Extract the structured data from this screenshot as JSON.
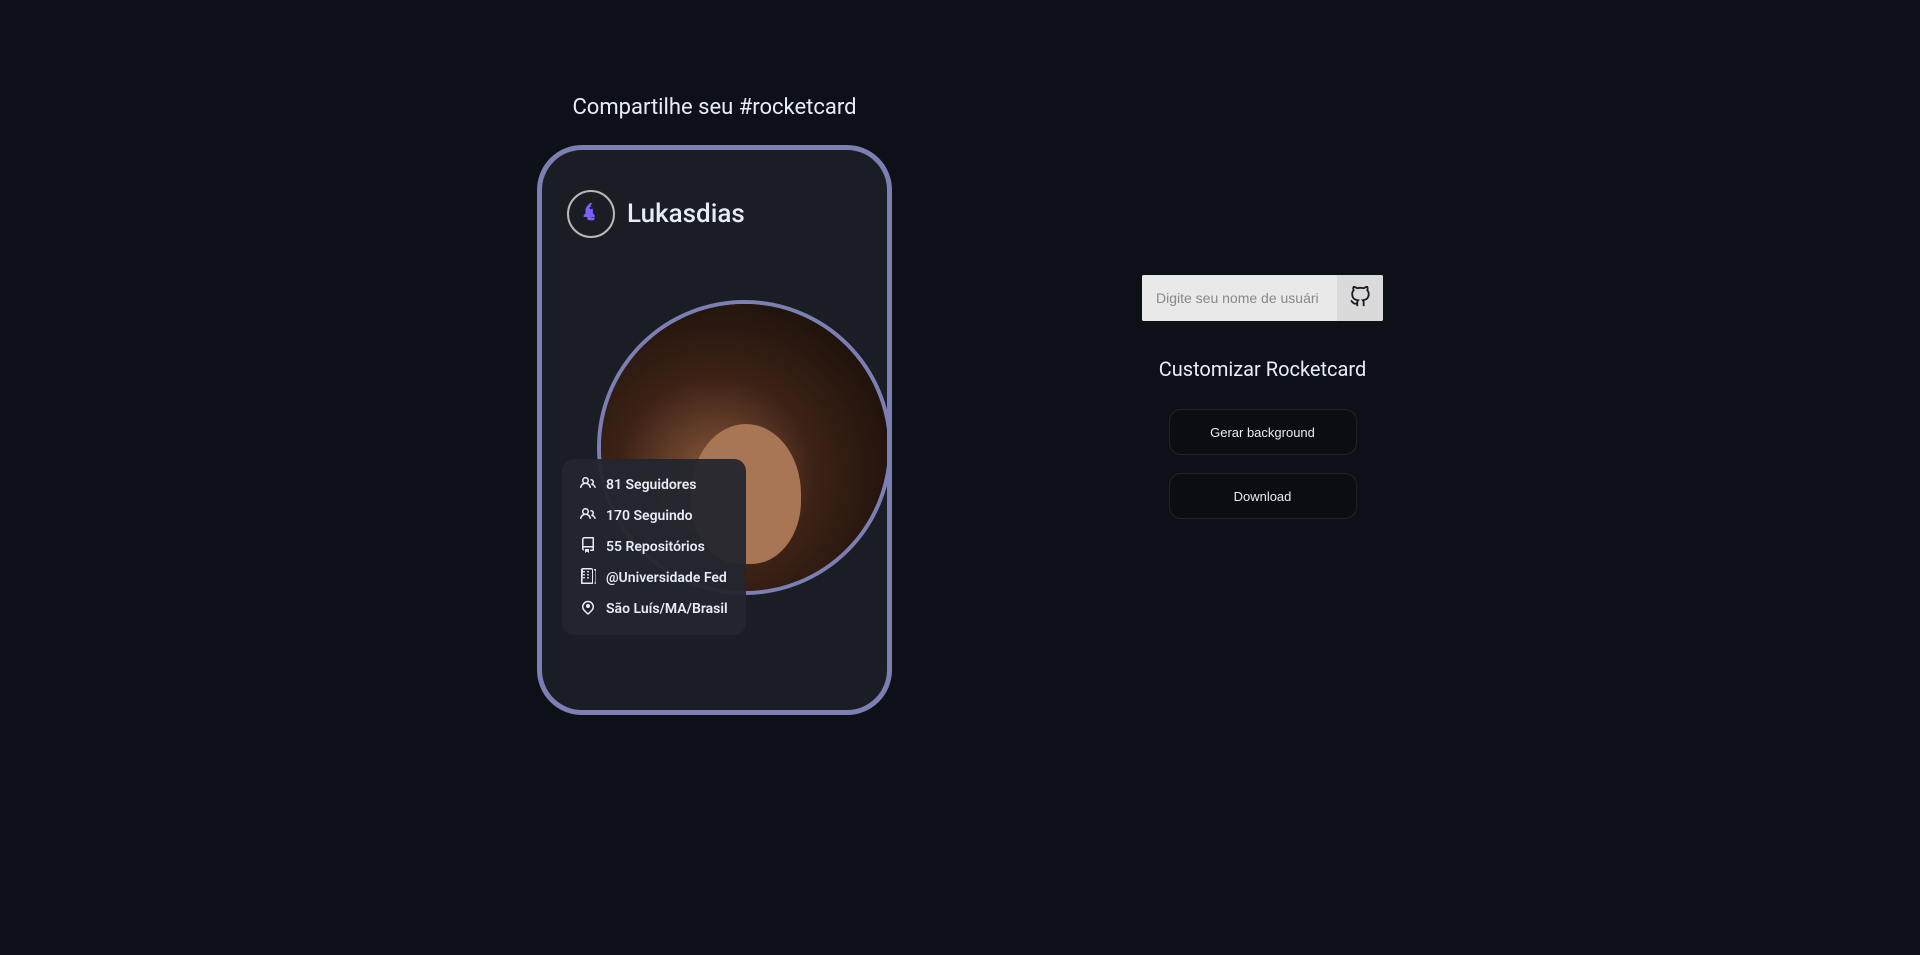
{
  "share_title": "Compartilhe seu #rocketcard",
  "card": {
    "username": "Lukasdias",
    "stats": {
      "followers_count": "81",
      "followers_label": "Seguidores",
      "following_count": "170",
      "following_label": "Seguindo",
      "repos_count": "55",
      "repos_label": "Repositórios",
      "company": "@Universidade Fed",
      "location": "São Luís/MA/Brasil"
    }
  },
  "sidebar": {
    "search_placeholder": "Digite seu nome de usuári",
    "customize_title": "Customizar Rocketcard",
    "generate_bg_label": "Gerar background",
    "download_label": "Download"
  },
  "colors": {
    "background": "#0d1117",
    "card_bg": "#1a1d24",
    "border": "#7c7fb3",
    "accent": "#7b61ff"
  }
}
